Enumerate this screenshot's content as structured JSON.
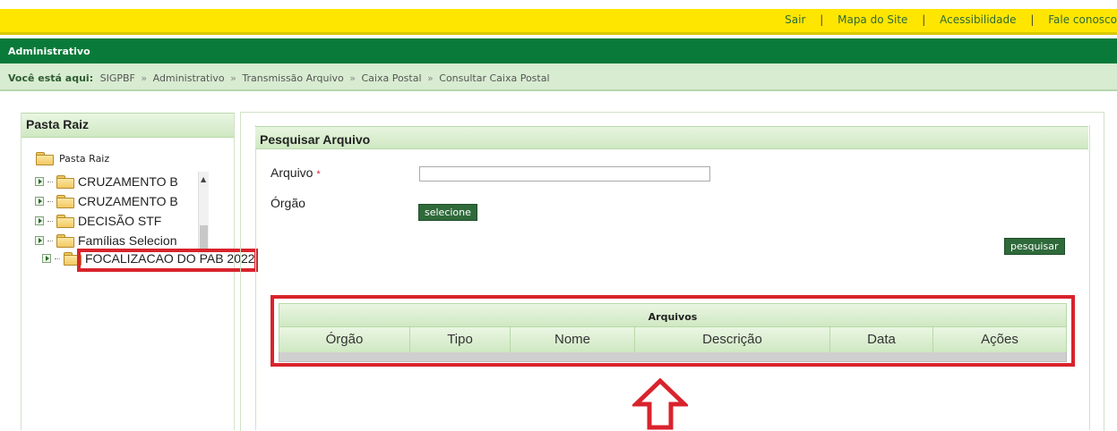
{
  "topbar": {
    "links": [
      "Sair",
      "Mapa do Site",
      "Acessibilidade",
      "Fale conosco"
    ],
    "separator": "|"
  },
  "admin_bar": {
    "title": "Administrativo"
  },
  "breadcrumb": {
    "prefix": "Você está aqui:",
    "items": [
      "SIGPBF",
      "Administrativo",
      "Transmissão Arquivo",
      "Caixa Postal",
      "Consultar Caixa Postal"
    ],
    "separator": "»"
  },
  "tree": {
    "header": "Pasta Raiz",
    "root_label": "Pasta Raiz",
    "items": [
      "CRUZAMENTO B",
      "CRUZAMENTO B",
      "DECISÃO STF",
      "Famílias Selecion"
    ],
    "highlighted_item": "FOCALIZACAO DO PAB 2022"
  },
  "search": {
    "header": "Pesquisar Arquivo",
    "arquivo_label": "Arquivo",
    "required_mark": "*",
    "arquivo_value": "",
    "orgao_label": "Órgão",
    "select_button": "selecione",
    "search_button": "pesquisar"
  },
  "files_table": {
    "title": "Arquivos",
    "columns": [
      "Órgão",
      "Tipo",
      "Nome",
      "Descrição",
      "Data",
      "Ações"
    ]
  },
  "colors": {
    "topbar": "#ffe600",
    "admin_bar": "#0a7a3a",
    "breadcrumb_bg": "#d8ecd1",
    "highlight": "#d9232c",
    "button": "#2f6a3b"
  },
  "icons": {
    "folder": "folder-icon",
    "expander": "expand-icon",
    "scroll_up": "scroll-up-icon",
    "annotation": "arrow-up-icon"
  }
}
